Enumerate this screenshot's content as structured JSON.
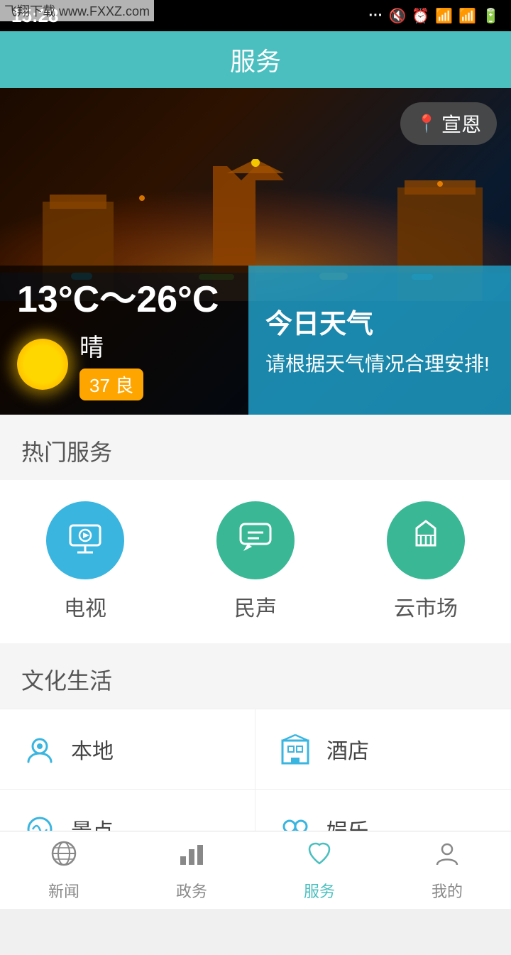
{
  "statusBar": {
    "time": "15:28",
    "watermark": "飞翔下载 www.FXXZ.com"
  },
  "topBar": {
    "title": "服务"
  },
  "weather": {
    "location": "宣恩",
    "temperature": "13°C～26°C",
    "condition": "晴",
    "airQuality": "37 良",
    "todayLabel": "今日天气",
    "description": "请根据天气情况合理安排!"
  },
  "hotServices": {
    "sectionLabel": "热门服务",
    "items": [
      {
        "label": "电视",
        "icon": "tv"
      },
      {
        "label": "民声",
        "icon": "chat"
      },
      {
        "label": "云市场",
        "icon": "market"
      }
    ]
  },
  "cultureSection": {
    "sectionLabel": "文化生活",
    "items": [
      {
        "label": "本地",
        "icon": "📍"
      },
      {
        "label": "酒店",
        "icon": "🏢"
      },
      {
        "label": "景点",
        "icon": "🎭"
      },
      {
        "label": "娱乐",
        "icon": "🎭"
      }
    ]
  },
  "bottomNav": {
    "items": [
      {
        "label": "新闻",
        "icon": "globe",
        "active": false
      },
      {
        "label": "政务",
        "icon": "bar-chart",
        "active": false
      },
      {
        "label": "服务",
        "icon": "heart",
        "active": true
      },
      {
        "label": "我的",
        "icon": "person",
        "active": false
      }
    ]
  }
}
